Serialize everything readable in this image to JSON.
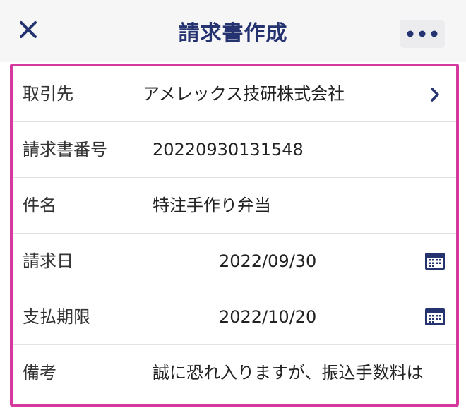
{
  "header": {
    "title": "請求書作成",
    "close_icon": "close-icon",
    "more_icon": "more-horizontal-icon"
  },
  "form": {
    "client": {
      "label": "取引先",
      "value": "アメレックス技研株式会社"
    },
    "invoice_number": {
      "label": "請求書番号",
      "value": "20220930131548"
    },
    "subject": {
      "label": "件名",
      "value": "特注手作り弁当"
    },
    "invoice_date": {
      "label": "請求日",
      "value": "2022/09/30"
    },
    "due_date": {
      "label": "支払期限",
      "value": "2022/10/20"
    },
    "memo": {
      "label": "備考",
      "value": "誠に恐れ入りますが、振込手数料は"
    }
  },
  "colors": {
    "title": "#253370",
    "highlight_border": "#d6399e",
    "icon": "#253370"
  }
}
